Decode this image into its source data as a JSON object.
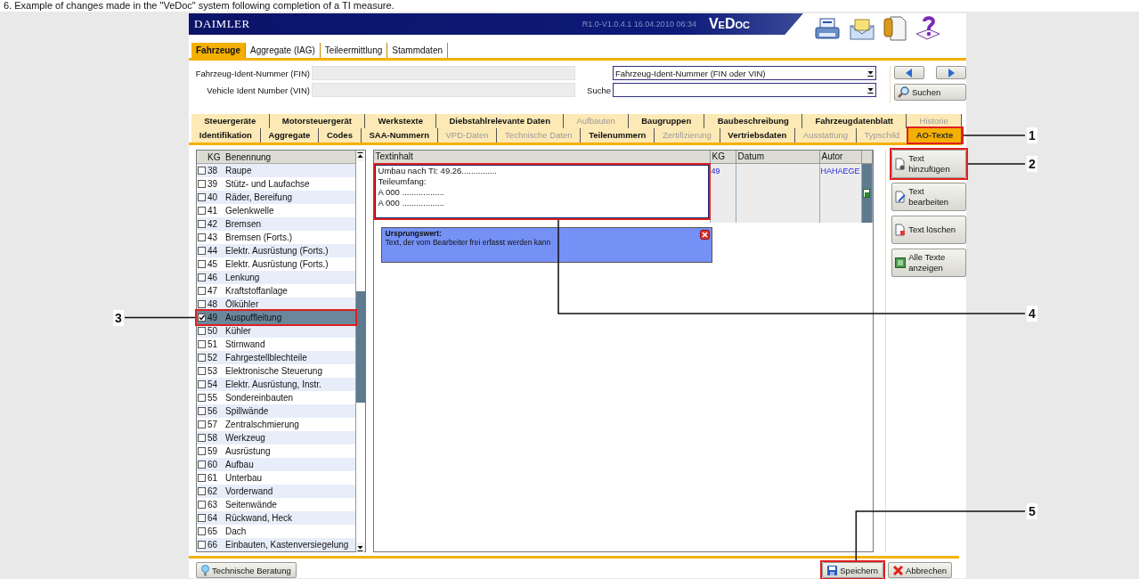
{
  "caption": "6. Example of changes made in the \"VeDoc\" system following completion of a TI measure.",
  "header": {
    "brand": "DAIMLER",
    "version": "R1.0-V1.0.4.1 16.04.2010 06:34",
    "product": "VeDoc"
  },
  "main_tabs": [
    {
      "label": "Fahrzeuge",
      "selected": true
    },
    {
      "label": "Aggregate (IAG)",
      "selected": false
    },
    {
      "label": "Teileermittlung",
      "selected": false
    },
    {
      "label": "Stammdaten",
      "selected": false
    }
  ],
  "search_form": {
    "fin_label": "Fahrzeug-Ident-Nummer (FIN)",
    "vin_label": "Vehicle Ident Number (VIN)",
    "type_select": "Fahrzeug-Ident-Nummer (FIN oder VIN)",
    "search_label": "Suche",
    "search_button": "Suchen"
  },
  "sub_tabs": [
    [
      {
        "label": "Steuergeräte",
        "selected": false,
        "disabled": false
      },
      {
        "label": "Motorsteuergerät",
        "selected": false,
        "disabled": false
      },
      {
        "label": "Werkstexte",
        "selected": false,
        "disabled": false
      },
      {
        "label": "Diebstahlrelevante Daten",
        "selected": false,
        "disabled": false
      },
      {
        "label": "Aufbauten",
        "selected": false,
        "disabled": true
      },
      {
        "label": "Baugruppen",
        "selected": false,
        "disabled": false
      },
      {
        "label": "Baubeschreibung",
        "selected": false,
        "disabled": false
      },
      {
        "label": "Fahrzeugdatenblatt",
        "selected": false,
        "disabled": false
      },
      {
        "label": "Historie",
        "selected": false,
        "disabled": true
      }
    ],
    [
      {
        "label": "Identifikation",
        "selected": false,
        "disabled": false
      },
      {
        "label": "Aggregate",
        "selected": false,
        "disabled": false
      },
      {
        "label": "Codes",
        "selected": false,
        "disabled": false
      },
      {
        "label": "SAA-Nummern",
        "selected": false,
        "disabled": false
      },
      {
        "label": "VPD-Daten",
        "selected": false,
        "disabled": true
      },
      {
        "label": "Technische Daten",
        "selected": false,
        "disabled": true
      },
      {
        "label": "Teilenummern",
        "selected": false,
        "disabled": false
      },
      {
        "label": "Zertifizierung",
        "selected": false,
        "disabled": true
      },
      {
        "label": "Vertriebsdaten",
        "selected": false,
        "disabled": false
      },
      {
        "label": "Ausstattung",
        "selected": false,
        "disabled": true
      },
      {
        "label": "Typschild",
        "selected": false,
        "disabled": true
      },
      {
        "label": "AO-Texte",
        "selected": true,
        "disabled": false,
        "callout": "1"
      }
    ]
  ],
  "kg_list": {
    "columns": [
      "KG",
      "Benennung"
    ],
    "rows": [
      {
        "kg": "38",
        "name": "Raupe",
        "checked": false,
        "selected": false
      },
      {
        "kg": "39",
        "name": "Stütz- und Laufachse",
        "checked": false,
        "selected": false
      },
      {
        "kg": "40",
        "name": "Räder, Bereifung",
        "checked": false,
        "selected": false
      },
      {
        "kg": "41",
        "name": "Gelenkwelle",
        "checked": false,
        "selected": false
      },
      {
        "kg": "42",
        "name": "Bremsen",
        "checked": false,
        "selected": false
      },
      {
        "kg": "43",
        "name": "Bremsen (Forts.)",
        "checked": false,
        "selected": false
      },
      {
        "kg": "44",
        "name": "Elektr. Ausrüstung (Forts.)",
        "checked": false,
        "selected": false
      },
      {
        "kg": "45",
        "name": "Elektr. Ausrüstung (Forts.)",
        "checked": false,
        "selected": false
      },
      {
        "kg": "46",
        "name": "Lenkung",
        "checked": false,
        "selected": false
      },
      {
        "kg": "47",
        "name": "Kraftstoffanlage",
        "checked": false,
        "selected": false
      },
      {
        "kg": "48",
        "name": "Ölkühler",
        "checked": false,
        "selected": false
      },
      {
        "kg": "49",
        "name": "Auspuffleitung",
        "checked": true,
        "selected": true,
        "callout": "3"
      },
      {
        "kg": "50",
        "name": "Kühler",
        "checked": false,
        "selected": false
      },
      {
        "kg": "51",
        "name": "Stirnwand",
        "checked": false,
        "selected": false
      },
      {
        "kg": "52",
        "name": "Fahrgestellblechteile",
        "checked": false,
        "selected": false
      },
      {
        "kg": "53",
        "name": "Elektronische Steuerung",
        "checked": false,
        "selected": false
      },
      {
        "kg": "54",
        "name": "Elektr. Ausrüstung, Instr.",
        "checked": false,
        "selected": false
      },
      {
        "kg": "55",
        "name": "Sondereinbauten",
        "checked": false,
        "selected": false
      },
      {
        "kg": "56",
        "name": "Spillwände",
        "checked": false,
        "selected": false
      },
      {
        "kg": "57",
        "name": "Zentralschmierung",
        "checked": false,
        "selected": false
      },
      {
        "kg": "58",
        "name": "Werkzeug",
        "checked": false,
        "selected": false
      },
      {
        "kg": "59",
        "name": "Ausrüstung",
        "checked": false,
        "selected": false
      },
      {
        "kg": "60",
        "name": "Aufbau",
        "checked": false,
        "selected": false
      },
      {
        "kg": "61",
        "name": "Unterbau",
        "checked": false,
        "selected": false
      },
      {
        "kg": "62",
        "name": "Vorderwand",
        "checked": false,
        "selected": false
      },
      {
        "kg": "63",
        "name": "Seitenwände",
        "checked": false,
        "selected": false
      },
      {
        "kg": "64",
        "name": "Rückwand, Heck",
        "checked": false,
        "selected": false
      },
      {
        "kg": "65",
        "name": "Dach",
        "checked": false,
        "selected": false
      },
      {
        "kg": "66",
        "name": "Einbauten, Kastenversiegelung",
        "checked": false,
        "selected": false
      }
    ]
  },
  "text_table": {
    "columns": [
      "Textinhalt",
      "KG",
      "Datum",
      "Autor"
    ],
    "rows": [
      {
        "text": "Umbau nach TI: 49.26...............\nTeileumfang:\nA 000 ..................\nA 000 ..................",
        "kg": "49",
        "autor": "HAHAEGE",
        "callout": "4"
      }
    ]
  },
  "tooltip": {
    "title": "Ursprungswert:",
    "text": "Text, der vom Bearbeiter frei erfasst werden kann"
  },
  "actions": [
    {
      "label": "Text hinzufügen",
      "kind": "add",
      "callout": "2"
    },
    {
      "label": "Text bearbeiten",
      "kind": "edit"
    },
    {
      "label": "Text löschen",
      "kind": "delete"
    },
    {
      "label": "Alle Texte anzeigen",
      "kind": "show_all"
    }
  ],
  "footer": {
    "left_buttons": [
      {
        "label": "Technische Beratung",
        "kind": "info"
      }
    ],
    "right_buttons": [
      {
        "label": "Speichern",
        "kind": "save",
        "callout": "5"
      },
      {
        "label": "Abbrechen",
        "kind": "cancel"
      }
    ]
  }
}
